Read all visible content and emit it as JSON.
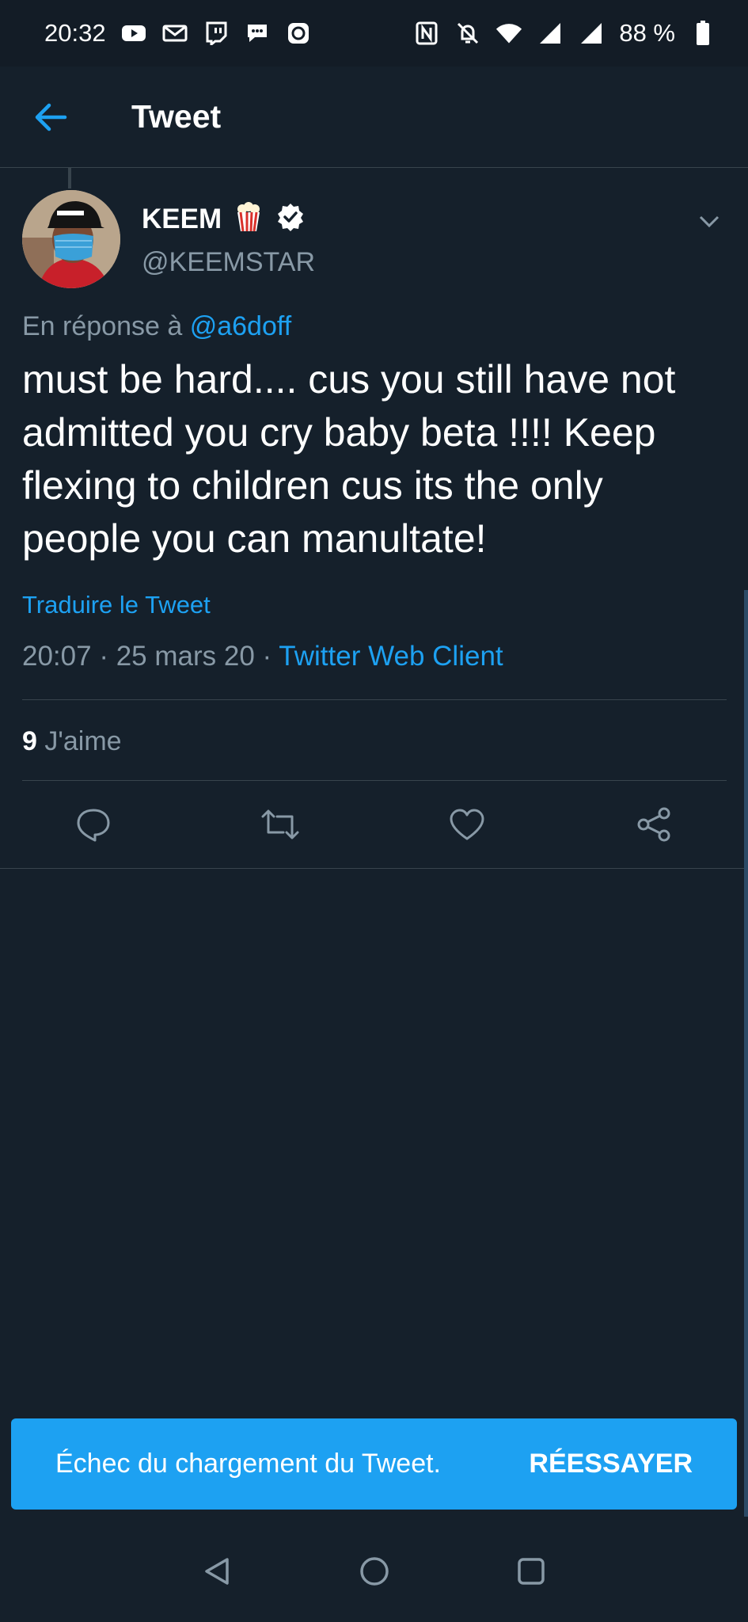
{
  "status_bar": {
    "time": "20:32",
    "battery": "88 %",
    "left_icons": [
      "youtube-icon",
      "gmail-icon",
      "twitch-icon",
      "message-icon",
      "vpn-icon"
    ],
    "right_icons": [
      "nfc-icon",
      "bell-off-icon",
      "wifi-icon",
      "signal-icon",
      "signal-icon",
      "battery-icon"
    ]
  },
  "app_bar": {
    "title": "Tweet"
  },
  "tweet": {
    "display_name": "KEEM",
    "handle": "@KEEMSTAR",
    "reply_prefix": "En réponse à",
    "reply_to": "@a6doff",
    "text": "must be hard.... cus you still have not admitted you cry baby beta !!!! Keep flexing to children cus its the only people you can manultate!",
    "translate": "Traduire le Tweet",
    "time": "20:07",
    "date": "25 mars 20",
    "separator": "·",
    "client": "Twitter Web Client",
    "like_count": "9",
    "like_label": "J'aime"
  },
  "snackbar": {
    "message": "Échec du chargement du Tweet.",
    "action": "RÉESSAYER"
  },
  "colors": {
    "background": "#15202b",
    "accent": "#1da1f2",
    "muted": "#8899a6",
    "divider": "#38444d"
  }
}
